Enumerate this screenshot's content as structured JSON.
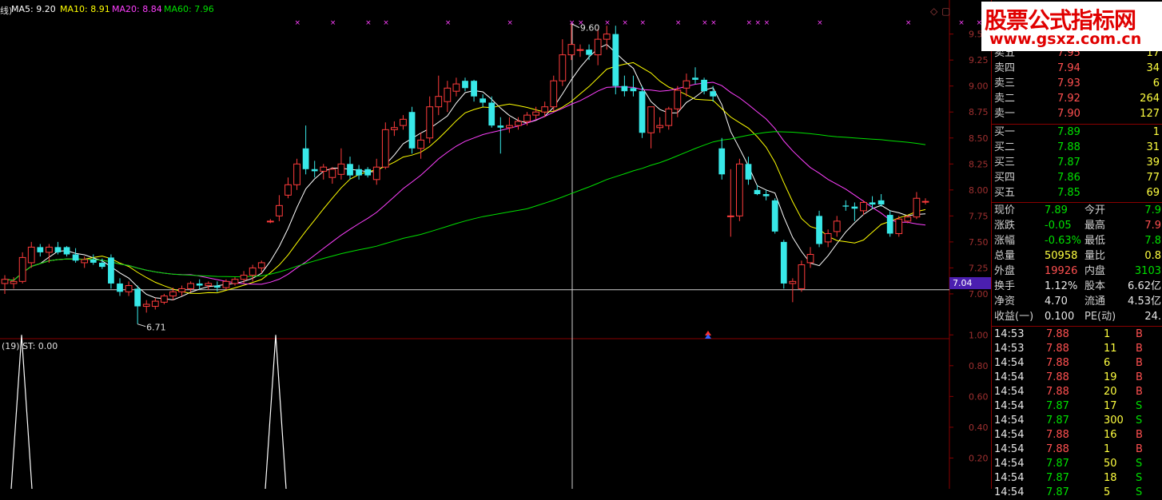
{
  "indicators_top": {
    "prefix": "线)",
    "ma5": "MA5: 9.20",
    "ma10": "MA10: 8.91",
    "ma20": "MA20: 8.84",
    "ma60": "MA60: 7.96",
    "colors": {
      "ma5": "#ffffff",
      "ma10": "#ffff00",
      "ma20": "#ff40ff",
      "ma60": "#00e000"
    }
  },
  "indicators_bottom": {
    "label": "(19)  ST: 0.00"
  },
  "watermark": {
    "title": "股票公式指标网",
    "url": "www.gsxz.com.cn"
  },
  "price_tag": "7.04",
  "chart_data": {
    "type": "candlestick",
    "y_axis_ticks": [
      "9.50",
      "9.25",
      "9.00",
      "8.75",
      "8.50",
      "8.25",
      "8.00",
      "7.75",
      "7.50",
      "7.25",
      "7.00"
    ],
    "ylim": [
      6.6,
      9.72
    ],
    "annotations": {
      "high": "9.60",
      "low": "6.71"
    },
    "candles": [
      {
        "o": 7.1,
        "h": 7.18,
        "l": 7.0,
        "c": 7.14
      },
      {
        "o": 7.1,
        "h": 7.16,
        "l": 7.05,
        "c": 7.12
      },
      {
        "o": 7.12,
        "h": 7.4,
        "l": 7.1,
        "c": 7.35
      },
      {
        "o": 7.3,
        "h": 7.5,
        "l": 7.25,
        "c": 7.45
      },
      {
        "o": 7.45,
        "h": 7.48,
        "l": 7.36,
        "c": 7.4
      },
      {
        "o": 7.4,
        "h": 7.48,
        "l": 7.3,
        "c": 7.45
      },
      {
        "o": 7.45,
        "h": 7.5,
        "l": 7.38,
        "c": 7.4
      },
      {
        "o": 7.45,
        "h": 7.46,
        "l": 7.36,
        "c": 7.38
      },
      {
        "o": 7.38,
        "h": 7.44,
        "l": 7.3,
        "c": 7.32
      },
      {
        "o": 7.3,
        "h": 7.36,
        "l": 7.25,
        "c": 7.33
      },
      {
        "o": 7.33,
        "h": 7.38,
        "l": 7.28,
        "c": 7.3
      },
      {
        "o": 7.3,
        "h": 7.34,
        "l": 7.24,
        "c": 7.26
      },
      {
        "o": 7.35,
        "h": 7.38,
        "l": 7.05,
        "c": 7.1
      },
      {
        "o": 7.1,
        "h": 7.15,
        "l": 6.98,
        "c": 7.02
      },
      {
        "o": 7.02,
        "h": 7.12,
        "l": 6.98,
        "c": 7.08
      },
      {
        "o": 7.05,
        "h": 7.08,
        "l": 6.71,
        "c": 6.88
      },
      {
        "o": 6.88,
        "h": 6.94,
        "l": 6.82,
        "c": 6.9
      },
      {
        "o": 6.88,
        "h": 6.96,
        "l": 6.85,
        "c": 6.93
      },
      {
        "o": 6.92,
        "h": 7.0,
        "l": 6.9,
        "c": 6.98
      },
      {
        "o": 6.98,
        "h": 7.06,
        "l": 6.94,
        "c": 7.02
      },
      {
        "o": 7.02,
        "h": 7.08,
        "l": 6.98,
        "c": 7.05
      },
      {
        "o": 7.05,
        "h": 7.12,
        "l": 7.02,
        "c": 7.1
      },
      {
        "o": 7.1,
        "h": 7.14,
        "l": 7.04,
        "c": 7.08
      },
      {
        "o": 7.08,
        "h": 7.12,
        "l": 7.04,
        "c": 7.1
      },
      {
        "o": 7.08,
        "h": 7.12,
        "l": 7.02,
        "c": 7.06
      },
      {
        "o": 7.06,
        "h": 7.14,
        "l": 7.04,
        "c": 7.12
      },
      {
        "o": 7.1,
        "h": 7.16,
        "l": 7.08,
        "c": 7.14
      },
      {
        "o": 7.14,
        "h": 7.22,
        "l": 7.1,
        "c": 7.18
      },
      {
        "o": 7.18,
        "h": 7.28,
        "l": 7.12,
        "c": 7.25
      },
      {
        "o": 7.25,
        "h": 7.32,
        "l": 7.2,
        "c": 7.3
      },
      {
        "o": 7.7,
        "h": 7.72,
        "l": 7.68,
        "c": 7.7
      },
      {
        "o": 7.75,
        "h": 7.95,
        "l": 7.7,
        "c": 7.85
      },
      {
        "o": 7.95,
        "h": 8.12,
        "l": 7.92,
        "c": 8.05
      },
      {
        "o": 8.05,
        "h": 8.3,
        "l": 8.0,
        "c": 8.25
      },
      {
        "o": 8.4,
        "h": 8.62,
        "l": 8.15,
        "c": 8.2
      },
      {
        "o": 8.2,
        "h": 8.28,
        "l": 8.12,
        "c": 8.18
      },
      {
        "o": 8.18,
        "h": 8.25,
        "l": 8.1,
        "c": 8.22
      },
      {
        "o": 8.12,
        "h": 8.22,
        "l": 8.06,
        "c": 8.2
      },
      {
        "o": 8.15,
        "h": 8.4,
        "l": 8.1,
        "c": 8.25
      },
      {
        "o": 8.25,
        "h": 8.32,
        "l": 8.1,
        "c": 8.14
      },
      {
        "o": 8.2,
        "h": 8.24,
        "l": 8.1,
        "c": 8.14
      },
      {
        "o": 8.2,
        "h": 8.22,
        "l": 8.12,
        "c": 8.14
      },
      {
        "o": 8.1,
        "h": 8.3,
        "l": 8.05,
        "c": 8.22
      },
      {
        "o": 8.22,
        "h": 8.65,
        "l": 8.2,
        "c": 8.58
      },
      {
        "o": 8.58,
        "h": 8.66,
        "l": 8.52,
        "c": 8.6
      },
      {
        "o": 8.62,
        "h": 8.72,
        "l": 8.58,
        "c": 8.68
      },
      {
        "o": 8.75,
        "h": 8.8,
        "l": 8.35,
        "c": 8.4
      },
      {
        "o": 8.4,
        "h": 8.55,
        "l": 8.3,
        "c": 8.48
      },
      {
        "o": 8.5,
        "h": 8.9,
        "l": 8.45,
        "c": 8.8
      },
      {
        "o": 8.8,
        "h": 9.1,
        "l": 8.72,
        "c": 8.9
      },
      {
        "o": 8.85,
        "h": 9.05,
        "l": 8.75,
        "c": 8.98
      },
      {
        "o": 8.95,
        "h": 9.08,
        "l": 8.9,
        "c": 9.02
      },
      {
        "o": 9.05,
        "h": 9.08,
        "l": 8.95,
        "c": 8.98
      },
      {
        "o": 9.05,
        "h": 9.06,
        "l": 8.85,
        "c": 8.9
      },
      {
        "o": 8.88,
        "h": 8.92,
        "l": 8.8,
        "c": 8.84
      },
      {
        "o": 8.84,
        "h": 8.9,
        "l": 8.6,
        "c": 8.62
      },
      {
        "o": 8.62,
        "h": 8.7,
        "l": 8.35,
        "c": 8.6
      },
      {
        "o": 8.6,
        "h": 8.7,
        "l": 8.55,
        "c": 8.62
      },
      {
        "o": 8.62,
        "h": 8.7,
        "l": 8.58,
        "c": 8.66
      },
      {
        "o": 8.66,
        "h": 8.75,
        "l": 8.62,
        "c": 8.72
      },
      {
        "o": 8.72,
        "h": 8.8,
        "l": 8.68,
        "c": 8.75
      },
      {
        "o": 8.75,
        "h": 8.85,
        "l": 8.7,
        "c": 8.8
      },
      {
        "o": 8.8,
        "h": 9.1,
        "l": 8.76,
        "c": 9.05
      },
      {
        "o": 9.05,
        "h": 9.45,
        "l": 9.0,
        "c": 9.3
      },
      {
        "o": 9.3,
        "h": 9.6,
        "l": 9.25,
        "c": 9.4
      },
      {
        "o": 9.35,
        "h": 9.4,
        "l": 9.28,
        "c": 9.35
      },
      {
        "o": 9.35,
        "h": 9.4,
        "l": 9.25,
        "c": 9.3
      },
      {
        "o": 9.3,
        "h": 9.55,
        "l": 9.2,
        "c": 9.45
      },
      {
        "o": 9.45,
        "h": 9.58,
        "l": 9.35,
        "c": 9.5
      },
      {
        "o": 9.5,
        "h": 9.58,
        "l": 8.92,
        "c": 9.0
      },
      {
        "o": 9.0,
        "h": 9.1,
        "l": 8.9,
        "c": 8.95
      },
      {
        "o": 8.98,
        "h": 9.1,
        "l": 8.9,
        "c": 8.95
      },
      {
        "o": 8.95,
        "h": 9.0,
        "l": 8.5,
        "c": 8.55
      },
      {
        "o": 8.55,
        "h": 8.8,
        "l": 8.4,
        "c": 8.8
      },
      {
        "o": 8.6,
        "h": 8.7,
        "l": 8.55,
        "c": 8.62
      },
      {
        "o": 8.62,
        "h": 8.8,
        "l": 8.58,
        "c": 8.78
      },
      {
        "o": 8.78,
        "h": 9.0,
        "l": 8.7,
        "c": 8.96
      },
      {
        "o": 8.98,
        "h": 9.12,
        "l": 8.9,
        "c": 9.05
      },
      {
        "o": 9.08,
        "h": 9.18,
        "l": 9.02,
        "c": 9.06
      },
      {
        "o": 9.06,
        "h": 9.08,
        "l": 8.92,
        "c": 8.95
      },
      {
        "o": 8.95,
        "h": 9.0,
        "l": 8.85,
        "c": 8.9
      },
      {
        "o": 8.4,
        "h": 8.5,
        "l": 8.1,
        "c": 8.15
      },
      {
        "o": 7.75,
        "h": 8.2,
        "l": 7.55,
        "c": 7.75
      },
      {
        "o": 7.75,
        "h": 8.3,
        "l": 7.7,
        "c": 8.25
      },
      {
        "o": 8.25,
        "h": 8.32,
        "l": 8.05,
        "c": 8.1
      },
      {
        "o": 8.0,
        "h": 8.05,
        "l": 7.95,
        "c": 7.96
      },
      {
        "o": 7.96,
        "h": 8.0,
        "l": 7.9,
        "c": 7.94
      },
      {
        "o": 7.9,
        "h": 7.92,
        "l": 7.58,
        "c": 7.6
      },
      {
        "o": 7.5,
        "h": 7.52,
        "l": 7.05,
        "c": 7.1
      },
      {
        "o": 7.1,
        "h": 7.15,
        "l": 6.92,
        "c": 7.12
      },
      {
        "o": 7.05,
        "h": 7.32,
        "l": 7.02,
        "c": 7.28
      },
      {
        "o": 7.3,
        "h": 7.45,
        "l": 7.25,
        "c": 7.38
      },
      {
        "o": 7.75,
        "h": 7.8,
        "l": 7.45,
        "c": 7.48
      },
      {
        "o": 7.5,
        "h": 7.62,
        "l": 7.45,
        "c": 7.58
      },
      {
        "o": 7.6,
        "h": 7.75,
        "l": 7.55,
        "c": 7.7
      },
      {
        "o": 7.85,
        "h": 7.9,
        "l": 7.8,
        "c": 7.84
      },
      {
        "o": 7.84,
        "h": 7.88,
        "l": 7.7,
        "c": 7.82
      },
      {
        "o": 7.8,
        "h": 7.9,
        "l": 7.76,
        "c": 7.88
      },
      {
        "o": 7.88,
        "h": 7.94,
        "l": 7.82,
        "c": 7.86
      },
      {
        "o": 7.9,
        "h": 7.96,
        "l": 7.84,
        "c": 7.86
      },
      {
        "o": 7.76,
        "h": 7.8,
        "l": 7.55,
        "c": 7.58
      },
      {
        "o": 7.58,
        "h": 7.75,
        "l": 7.55,
        "c": 7.72
      },
      {
        "o": 7.7,
        "h": 7.76,
        "l": 7.68,
        "c": 7.74
      },
      {
        "o": 7.74,
        "h": 7.98,
        "l": 7.72,
        "c": 7.92
      },
      {
        "o": 7.89,
        "h": 7.92,
        "l": 7.86,
        "c": 7.89
      }
    ],
    "bottom_panel": {
      "y_axis_ticks": [
        "1.00",
        "0.80",
        "0.60",
        "0.40",
        "0.20"
      ],
      "ylim": [
        0,
        1.1
      ],
      "spikes_at_index": [
        1,
        29
      ]
    }
  },
  "quote_panel": {
    "asks": [
      {
        "label": "卖五",
        "price": "7.95",
        "vol": "17"
      },
      {
        "label": "卖四",
        "price": "7.94",
        "vol": "34"
      },
      {
        "label": "卖三",
        "price": "7.93",
        "vol": "6"
      },
      {
        "label": "卖二",
        "price": "7.92",
        "vol": "264"
      },
      {
        "label": "卖一",
        "price": "7.90",
        "vol": "127"
      }
    ],
    "bids": [
      {
        "label": "买一",
        "price": "7.89",
        "vol": "1"
      },
      {
        "label": "买二",
        "price": "7.88",
        "vol": "31"
      },
      {
        "label": "买三",
        "price": "7.87",
        "vol": "39"
      },
      {
        "label": "买四",
        "price": "7.86",
        "vol": "77"
      },
      {
        "label": "买五",
        "price": "7.85",
        "vol": "69"
      }
    ],
    "stats": [
      {
        "l1": "现价",
        "v1": "7.89",
        "c1": "grn",
        "l2": "今开",
        "v2": "7.9",
        "c2": "grn"
      },
      {
        "l1": "涨跌",
        "v1": "-0.05",
        "c1": "grn",
        "l2": "最高",
        "v2": "7.9",
        "c2": "red"
      },
      {
        "l1": "涨幅",
        "v1": "-0.63%",
        "c1": "grn",
        "l2": "最低",
        "v2": "7.8",
        "c2": "grn"
      },
      {
        "l1": "总量",
        "v1": "50958",
        "c1": "yel",
        "l2": "量比",
        "v2": "0.8",
        "c2": "yel"
      },
      {
        "l1": "外盘",
        "v1": "19926",
        "c1": "red",
        "l2": "内盘",
        "v2": "3103",
        "c2": "grn"
      },
      {
        "l1": "换手",
        "v1": "1.12%",
        "c1": "wht",
        "l2": "股本",
        "v2": "6.62亿",
        "c2": "wht"
      },
      {
        "l1": "净资",
        "v1": "4.70",
        "c1": "wht",
        "l2": "流通",
        "v2": "4.53亿",
        "c2": "wht"
      },
      {
        "l1": "收益(一)",
        "v1": "0.100",
        "c1": "wht",
        "l2": "PE(动)",
        "v2": "24.",
        "c2": "wht"
      }
    ],
    "ticks": [
      {
        "t": "14:53",
        "p": "7.88",
        "v": "1",
        "s": "B"
      },
      {
        "t": "14:53",
        "p": "7.88",
        "v": "11",
        "s": "B"
      },
      {
        "t": "14:54",
        "p": "7.88",
        "v": "6",
        "s": "B"
      },
      {
        "t": "14:54",
        "p": "7.88",
        "v": "19",
        "s": "B"
      },
      {
        "t": "14:54",
        "p": "7.88",
        "v": "20",
        "s": "B"
      },
      {
        "t": "14:54",
        "p": "7.87",
        "v": "17",
        "s": "S"
      },
      {
        "t": "14:54",
        "p": "7.87",
        "v": "300",
        "s": "S"
      },
      {
        "t": "14:54",
        "p": "7.88",
        "v": "16",
        "s": "B"
      },
      {
        "t": "14:54",
        "p": "7.88",
        "v": "1",
        "s": "B"
      },
      {
        "t": "14:54",
        "p": "7.87",
        "v": "50",
        "s": "S"
      },
      {
        "t": "14:54",
        "p": "7.87",
        "v": "18",
        "s": "S"
      },
      {
        "t": "14:54",
        "p": "7.87",
        "v": "5",
        "s": "S"
      }
    ]
  }
}
